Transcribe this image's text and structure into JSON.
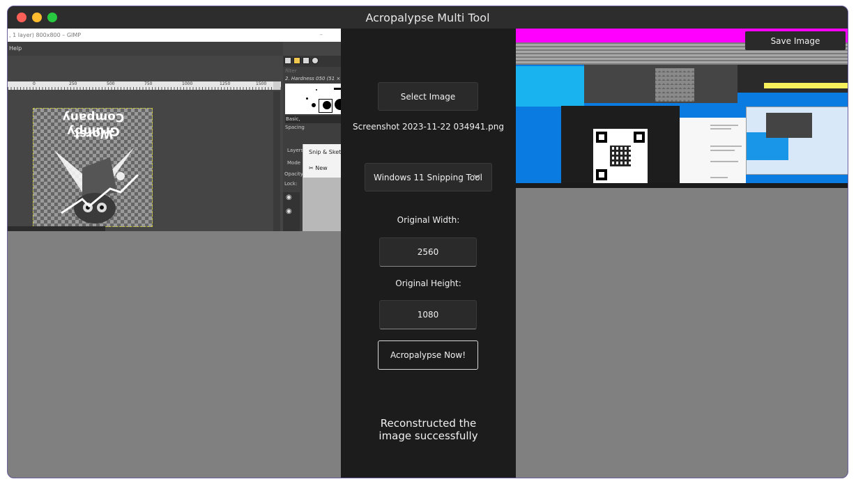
{
  "window": {
    "title": "Acropalypse Multi Tool"
  },
  "left_preview": {
    "title_text": ", 1 layer) 800x800 – GIMP",
    "menu_text": "Help",
    "ruler_ticks": [
      "0",
      "250",
      "500",
      "750",
      "1000",
      "1250",
      "1500"
    ],
    "canvas_text_line1": "Grumpy Company",
    "canvas_text_line2": "Worst",
    "dock": {
      "filter_placeholder": "filter",
      "brush_name": "2. Hardness 050 (51 × 51)",
      "preset_label": "Basic,",
      "spacing_label": "Spacing",
      "layers_tab": "Layers",
      "mode_label": "Mode",
      "opacity_label": "Opacity",
      "lock_label": "Lock:"
    },
    "snip": {
      "title": "Snip & Sketch",
      "new_label": "New"
    }
  },
  "controls": {
    "select_button": "Select Image",
    "filename": "Screenshot 2023-11-22 034941.png",
    "tool_select": {
      "selected": "Windows 11 Snipping Tool"
    },
    "width_label": "Original Width:",
    "width_value": "2560",
    "height_label": "Original Height:",
    "height_value": "1080",
    "run_button": "Acropalypse Now!",
    "status_message": "Reconstructed the image successfully"
  },
  "right_preview": {
    "save_button": "Save Image"
  },
  "colors": {
    "traffic_red": "#fe5f57",
    "traffic_yellow": "#febc2e",
    "traffic_green": "#28c840",
    "glitch_magenta": "#ff00ff",
    "panel_bg": "#1c1c1c"
  }
}
